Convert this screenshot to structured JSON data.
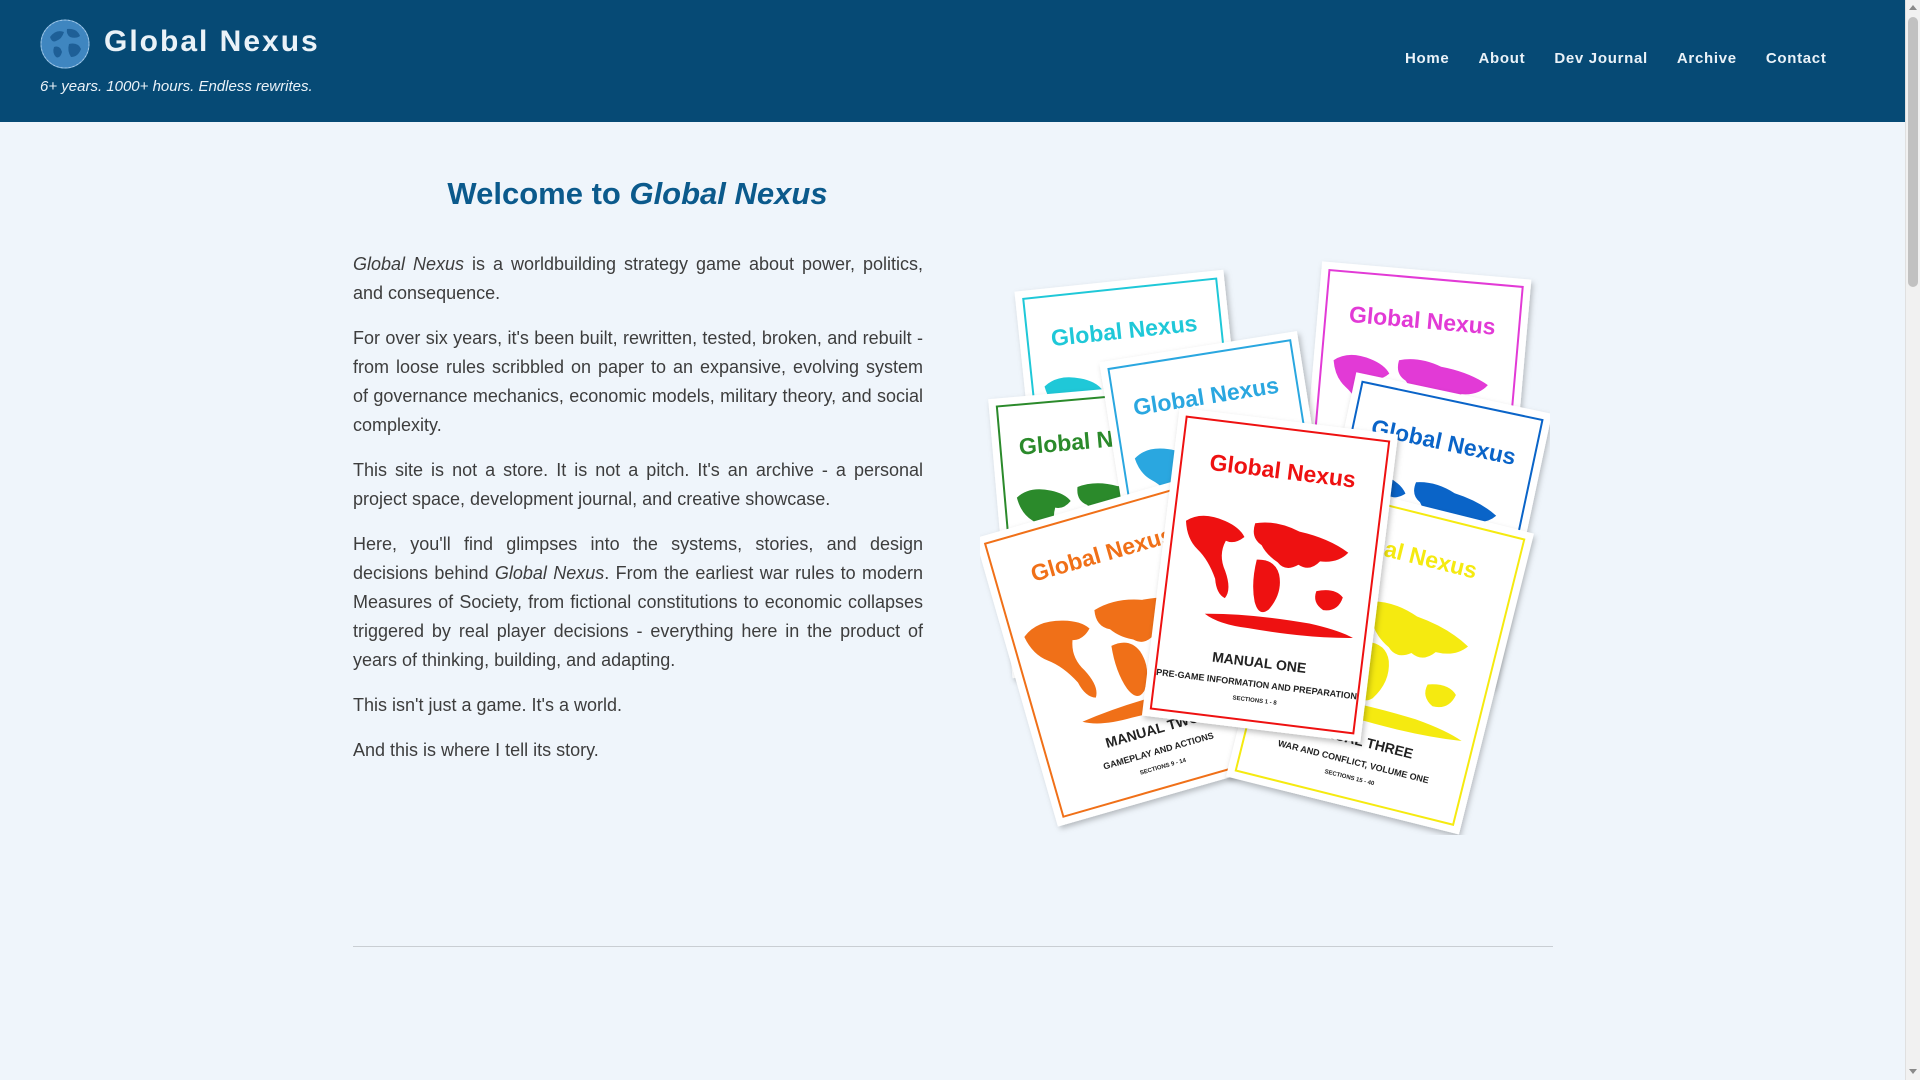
{
  "header": {
    "brand_title": "Global Nexus",
    "tagline": "6+ years. 1000+ hours. Endless rewrites.",
    "logo_icon": "globe-icon",
    "background_color": "#064a75"
  },
  "nav": {
    "items": [
      {
        "label": "Home"
      },
      {
        "label": "About"
      },
      {
        "label": "Dev Journal"
      },
      {
        "label": "Archive"
      },
      {
        "label": "Contact"
      }
    ]
  },
  "main": {
    "heading_prefix": "Welcome to ",
    "heading_emphasis": "Global Nexus",
    "paragraphs": {
      "p1_italic": "Global Nexus",
      "p1_rest": " is a worldbuilding strategy game about power, politics, and consequence.",
      "p2": "For over six years, it's been built, rewritten, tested, broken, and rebuilt - from loose rules scribbled on paper to an expansive, evolving system of governance mechanics, economic models, military theory, and social complexity.",
      "p3": "This site is not a store. It is not a pitch. It's an archive - a personal project space, development journal, and creative showcase.",
      "p4_start": "Here, you'll find glimpses into the systems, stories, and design decisions behind ",
      "p4_italic": "Global Nexus",
      "p4_end": ". From the earliest war rules to modern Measures of Society, from fictional constitutions to economic collapses triggered by real player decisions - everything here in the product of years of thinking, building, and adapting.",
      "p5": "This isn't just a game. It's a world.",
      "p6": "And this is where I tell its story."
    }
  },
  "manuals": {
    "brand": "Global Nexus",
    "covers": [
      {
        "color": "#1fc8d8"
      },
      {
        "color": "#e23ad6"
      },
      {
        "color": "#2b8a2b"
      },
      {
        "color": "#2aa7e0"
      },
      {
        "color": "#0a64c8"
      },
      {
        "color": "#f07018",
        "line1": "MANUAL TWO",
        "line2": "GAMEPLAY AND ACTIONS",
        "line3": "SECTIONS 9 - 14"
      },
      {
        "color": "#f5ea10",
        "line1": "MANUAL THREE",
        "line2": "WAR AND CONFLICT, VOLUME ONE",
        "line3": "SECTIONS 15 - 40"
      },
      {
        "color": "#ee1111",
        "line1": "MANUAL ONE",
        "line2": "PRE-GAME INFORMATION AND PREPARATION",
        "line3": "SECTIONS 1 - 8"
      }
    ]
  }
}
